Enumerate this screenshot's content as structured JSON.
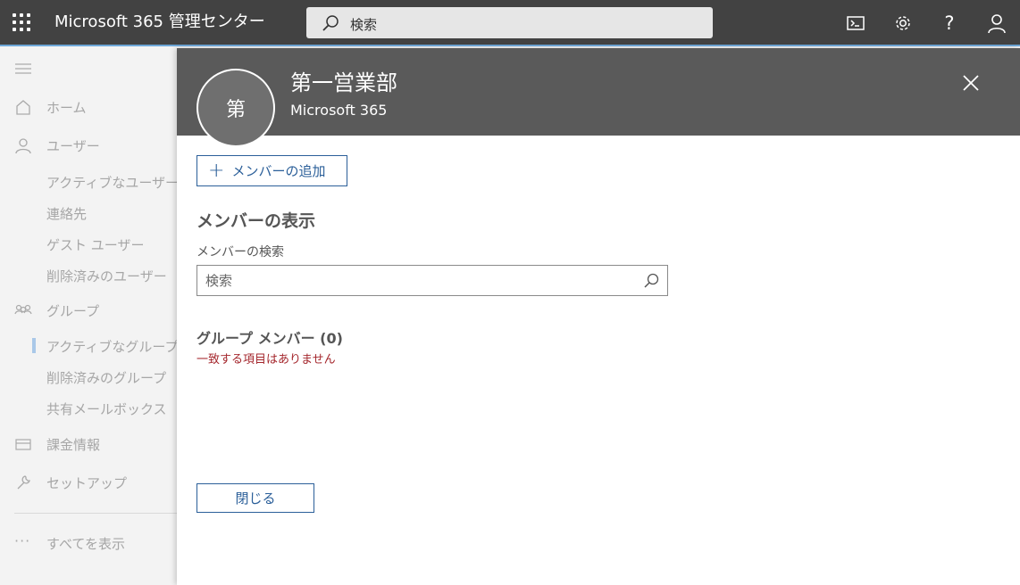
{
  "topbar": {
    "app_title": "Microsoft 365 管理センター",
    "search_placeholder": "検索",
    "icons": [
      "waffle-icon",
      "search-icon",
      "terminal-icon",
      "gear-icon",
      "help-icon",
      "user-icon"
    ]
  },
  "sidebar": {
    "items": [
      {
        "label": "ホーム",
        "icon": "home-icon"
      },
      {
        "label": "ユーザー",
        "icon": "user-icon"
      },
      {
        "label": "アクティブなユーザー"
      },
      {
        "label": "連絡先"
      },
      {
        "label": "ゲスト ユーザー"
      },
      {
        "label": "削除済みのユーザー"
      },
      {
        "label": "グループ",
        "icon": "group-icon"
      },
      {
        "label": "アクティブなグループ"
      },
      {
        "label": "削除済みのグループ"
      },
      {
        "label": "共有メールボックス"
      },
      {
        "label": "課金情報",
        "icon": "billing-icon"
      },
      {
        "label": "セットアップ",
        "icon": "wrench-icon"
      },
      {
        "label": "すべてを表示",
        "icon": "ellipsis-icon"
      }
    ]
  },
  "panel": {
    "avatar_initial": "第",
    "group_name": "第一営業部",
    "group_type": "Microsoft 365",
    "add_member_label": "メンバーの追加",
    "section_title": "メンバーの表示",
    "search_label": "メンバーの検索",
    "search_placeholder": "検索",
    "members_heading": "グループ メンバー (0)",
    "no_match_text": "一致する項目はありません",
    "close_label": "閉じる"
  },
  "colors": {
    "topbar": "#424242",
    "header": "#5a5a5a",
    "accent": "#2b5f99",
    "error": "#a4262c"
  }
}
